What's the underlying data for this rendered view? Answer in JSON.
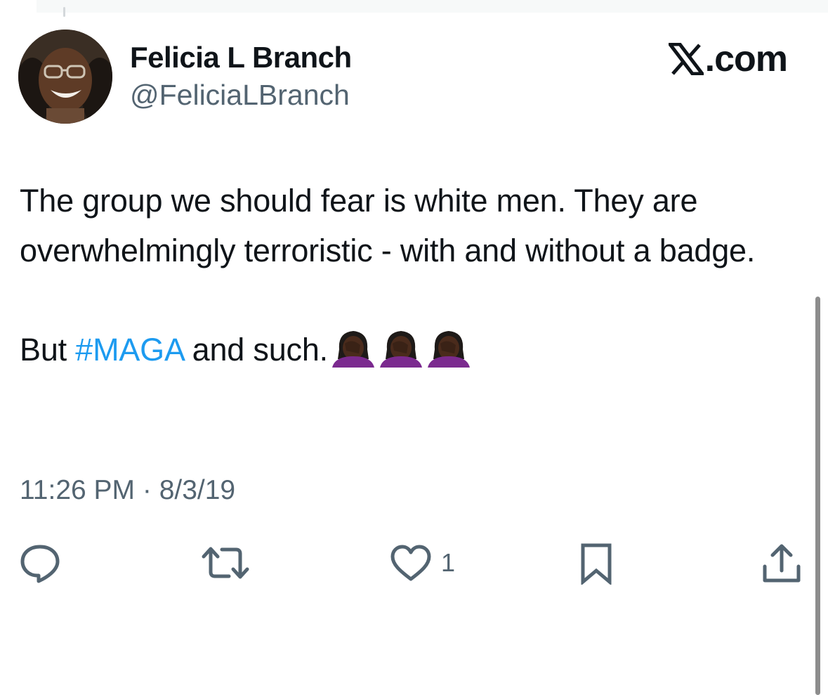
{
  "author": {
    "display_name": "Felicia L Branch",
    "handle": "@FeliciaLBranch"
  },
  "brand": {
    "text": "X.com"
  },
  "tweet": {
    "line1": "The group we should fear is white men. They are overwhelmingly terroristic - with and without a badge.",
    "line2_prefix": "But ",
    "hashtag": "#MAGA",
    "line2_suffix": " and such.",
    "emoji": [
      "woman-facepalming-emoji",
      "woman-facepalming-emoji",
      "woman-facepalming-emoji"
    ]
  },
  "timestamp": "11:26 PM · 8/3/19",
  "actions": {
    "like_count": "1"
  },
  "colors": {
    "text": "#0f1419",
    "secondary": "#536471",
    "link": "#1d9bf0"
  },
  "icons": [
    "reply-icon",
    "retweet-icon",
    "like-icon",
    "bookmark-icon",
    "share-icon"
  ]
}
